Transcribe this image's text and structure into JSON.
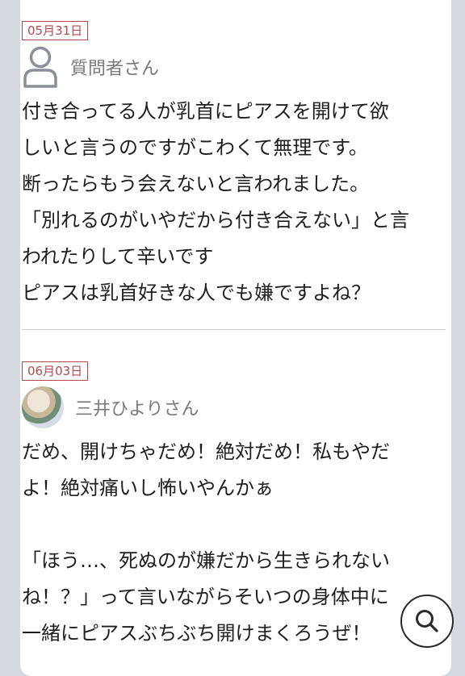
{
  "posts": [
    {
      "date": "05月31日",
      "author": "質問者さん",
      "author_icon": "person-icon",
      "lines": [
        "付き合ってる人が乳首にピアスを開けて欲",
        "しいと言うのですがこわくて無理です。",
        "断ったらもう会えないと言われました。",
        "「別れるのがいやだから付き合えない」と言",
        "われたりして辛いです",
        "ピアスは乳首好きな人でも嫌ですよね？"
      ]
    },
    {
      "date": "06月03日",
      "author": "三井ひよりさん",
      "lines": [
        "だめ、開けちゃだめ！絶対だめ！私もやだ",
        "よ！絶対痛いし怖いやんかぁ",
        "",
        "「ほう…、死ぬのが嫌だから生きられない",
        "ね！？」って言いながらそいつの身体中に",
        "一緒にピアスぶちぶち開けまくろうぜ！"
      ]
    }
  ],
  "search_button": {
    "icon": "search-icon"
  },
  "colors": {
    "date_border": "#b34a4a",
    "background": "#d6d9df"
  }
}
